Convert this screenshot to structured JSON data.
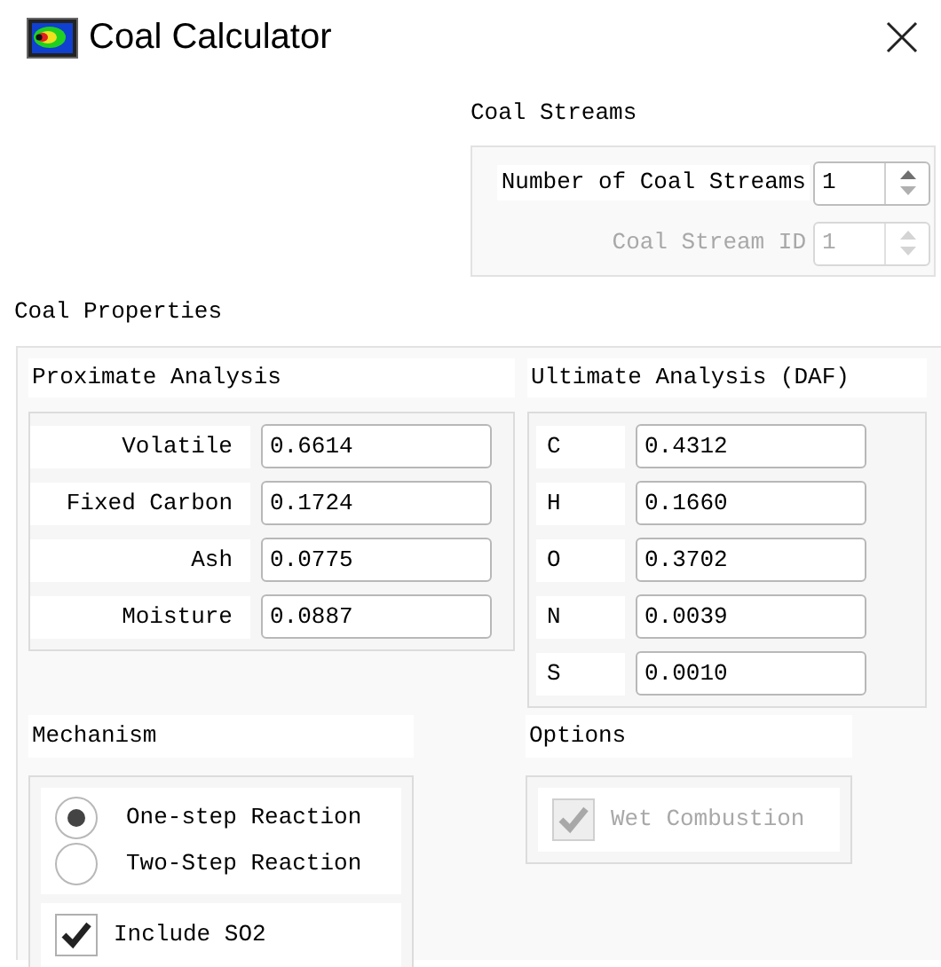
{
  "window": {
    "title": "Coal Calculator"
  },
  "coal_streams": {
    "title": "Coal Streams",
    "fields": [
      {
        "label": "Number of Coal Streams",
        "value": "1",
        "disabled": false
      },
      {
        "label": "Coal Stream ID",
        "value": "1",
        "disabled": true
      }
    ]
  },
  "coal_properties": {
    "title": "Coal Properties",
    "proximate": {
      "title": "Proximate Analysis",
      "fields": [
        {
          "label": "Volatile",
          "value": "0.6614"
        },
        {
          "label": "Fixed Carbon",
          "value": "0.1724"
        },
        {
          "label": "Ash",
          "value": "0.0775"
        },
        {
          "label": "Moisture",
          "value": "0.0887"
        }
      ]
    },
    "ultimate": {
      "title": "Ultimate Analysis (DAF)",
      "fields": [
        {
          "label": "C",
          "value": "0.4312"
        },
        {
          "label": "H",
          "value": "0.1660"
        },
        {
          "label": "O",
          "value": "0.3702"
        },
        {
          "label": "N",
          "value": "0.0039"
        },
        {
          "label": "S",
          "value": "0.0010"
        }
      ]
    }
  },
  "mechanism": {
    "title": "Mechanism",
    "reactions": [
      {
        "label": "One-step Reaction",
        "selected": true
      },
      {
        "label": "Two-Step Reaction",
        "selected": false
      }
    ],
    "include_so2": {
      "label": "Include SO2",
      "checked": true
    }
  },
  "options": {
    "title": "Options",
    "items": [
      {
        "label": "Wet Combustion",
        "checked": true,
        "disabled": true
      }
    ]
  }
}
